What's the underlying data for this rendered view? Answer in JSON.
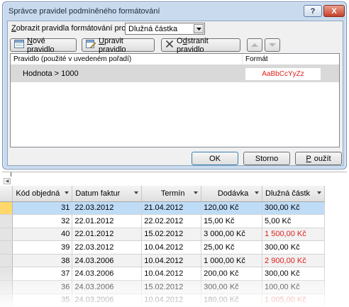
{
  "dialog": {
    "title": "Správce pravidel podmíněného formátování",
    "help_label": "?",
    "close_label": "X",
    "show_rules_label_u": "Z",
    "show_rules_label_rest": "obrazit pravidla formátování pro:",
    "show_rules_value": "Dlužná částka",
    "buttons": {
      "new_u": "N",
      "new_rest": "ové pravidlo",
      "edit_u": "U",
      "edit_rest": "pravit pravidlo",
      "delete_pre": "O",
      "delete_u": "d",
      "delete_rest": "stranit pravidlo",
      "ok": "OK",
      "cancel": "Storno",
      "apply_u": "P",
      "apply_rest": "oužít"
    },
    "rules_table": {
      "col_rule": "Pravidlo (použité v uvedeném pořadí)",
      "col_format": "Formát",
      "rows": [
        {
          "rule": "Hodnota > 1000",
          "format_sample": "AaBbCcYyZz",
          "sample_color": "#e0201c"
        }
      ]
    }
  },
  "datasheet": {
    "columns": [
      "Kód objedná",
      "Datum faktur",
      "Termín",
      "Dodávka",
      "Dlužná částk"
    ],
    "rows": [
      [
        "31",
        "22.03.2012",
        "21.04.2012",
        "120,00 Kč",
        "300,00 Kč"
      ],
      [
        "32",
        "22.01.2012",
        "22.02.2012",
        "15,00 Kč",
        "5,00 Kč"
      ],
      [
        "40",
        "22.01.2012",
        "15.02.2012",
        "3 000,00 Kč",
        "1 500,00 Kč"
      ],
      [
        "39",
        "22.03.2012",
        "10.04.2012",
        "25,00 Kč",
        "300,00 Kč"
      ],
      [
        "38",
        "24.03.2006",
        "10.04.2012",
        "1 000,00 Kč",
        "2 900,00 Kč"
      ],
      [
        "37",
        "24.03.2006",
        "10.04.2012",
        "200,00 Kč",
        "300,00 Kč"
      ],
      [
        "36",
        "24.03.2006",
        "15.02.2012",
        "300,00 Kč",
        "100,00 Kč"
      ],
      [
        "35",
        "24.03.2006",
        "10.04.2012",
        "180,00 Kč",
        "1 005,00 Kč"
      ]
    ],
    "highlight_color": "#e0201c"
  }
}
